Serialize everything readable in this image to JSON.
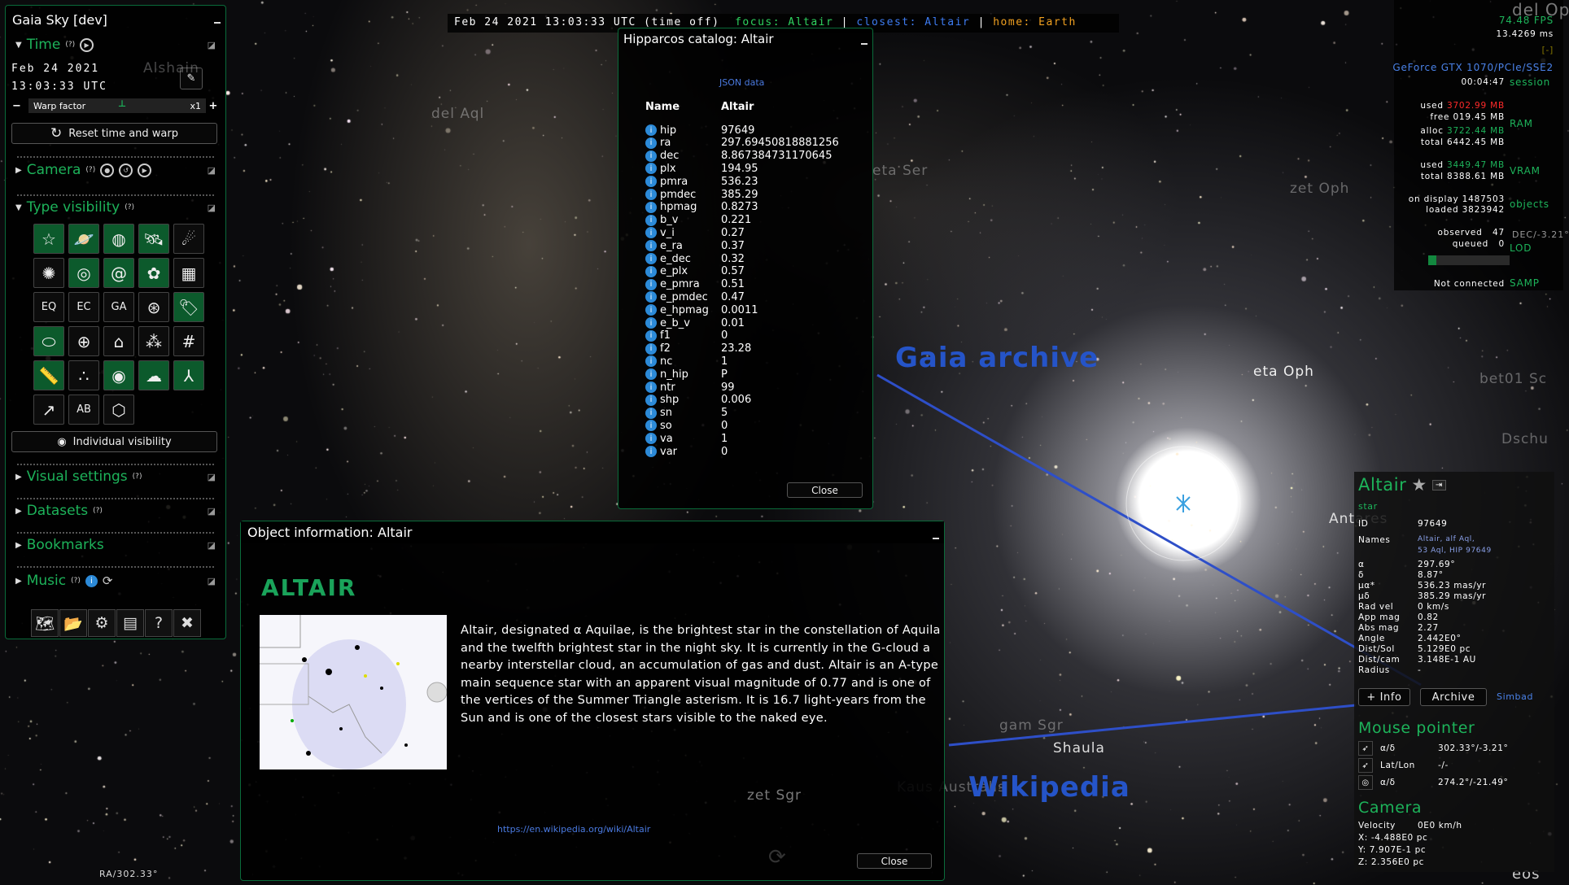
{
  "colors": {
    "accent": "#1db35a",
    "link": "#4a7ae0",
    "focus": "#2ed35f",
    "closest": "#3d7bf0",
    "home": "#f0a020",
    "warn": "#ff2a2a"
  },
  "left": {
    "title": "Gaia Sky [dev]",
    "time": {
      "label": "Time",
      "help": "(?)",
      "date": "Feb 24 2021",
      "clock": "13:03:33 UTC",
      "warp_label": "Warp factor",
      "warp_value": "x1",
      "reset": "Reset time and warp"
    },
    "camera": {
      "label": "Camera",
      "help": "(?)"
    },
    "type_visibility": {
      "label": "Type visibility",
      "help": "(?)",
      "items": [
        {
          "name": "stars",
          "glyph": "☆",
          "on": true
        },
        {
          "name": "planets",
          "glyph": "🪐",
          "on": true
        },
        {
          "name": "moons",
          "glyph": "◍",
          "on": true
        },
        {
          "name": "satellites",
          "glyph": "🛰",
          "on": true
        },
        {
          "name": "asteroids",
          "glyph": "☄",
          "on": false
        },
        {
          "name": "star-clusters",
          "glyph": "✺",
          "on": false
        },
        {
          "name": "galaxies",
          "glyph": "◎",
          "on": true
        },
        {
          "name": "milky-way",
          "glyph": "@",
          "on": true
        },
        {
          "name": "nebulae",
          "glyph": "✿",
          "on": true
        },
        {
          "name": "meshes",
          "glyph": "▦",
          "on": false
        },
        {
          "name": "equatorial-grid",
          "glyph": "EQ",
          "on": false
        },
        {
          "name": "ecliptic-grid",
          "glyph": "EC",
          "on": false
        },
        {
          "name": "galactic-grid",
          "glyph": "GA",
          "on": false
        },
        {
          "name": "orbits",
          "glyph": "⊛",
          "on": false
        },
        {
          "name": "labels",
          "glyph": "🏷",
          "on": true
        },
        {
          "name": "orbits-ellipse",
          "glyph": "⬭",
          "on": true
        },
        {
          "name": "locations",
          "glyph": "⊕",
          "on": false
        },
        {
          "name": "countries",
          "glyph": "⌂",
          "on": false
        },
        {
          "name": "constellations",
          "glyph": "⁂",
          "on": false
        },
        {
          "name": "boundaries",
          "glyph": "#",
          "on": false
        },
        {
          "name": "ruler",
          "glyph": "📏",
          "on": true
        },
        {
          "name": "particles",
          "glyph": "∴",
          "on": false
        },
        {
          "name": "atmospheres",
          "glyph": "◉",
          "on": true
        },
        {
          "name": "clouds",
          "glyph": "☁",
          "on": true
        },
        {
          "name": "axes",
          "glyph": "⅄",
          "on": true
        },
        {
          "name": "velocity-vectors",
          "glyph": "↗",
          "on": false
        },
        {
          "name": "titles",
          "glyph": "AB",
          "on": false
        },
        {
          "name": "others",
          "glyph": "⬡",
          "on": false
        }
      ]
    },
    "individual_visibility": "Individual visibility",
    "visual_settings": {
      "label": "Visual settings",
      "help": "(?)"
    },
    "datasets": {
      "label": "Datasets",
      "help": "(?)"
    },
    "bookmarks": {
      "label": "Bookmarks"
    },
    "music": {
      "label": "Music",
      "help": "(?)"
    },
    "bottom": [
      {
        "name": "map",
        "glyph": "🗺"
      },
      {
        "name": "open-folder",
        "glyph": "📂"
      },
      {
        "name": "settings",
        "glyph": "⚙"
      },
      {
        "name": "log",
        "glyph": "▤"
      },
      {
        "name": "help",
        "glyph": "?"
      },
      {
        "name": "quit",
        "glyph": "✖"
      }
    ]
  },
  "status": {
    "time": "Feb 24 2021 13:03:33 UTC (time off)",
    "focus": "focus: Altair",
    "closest": "closest: Altair",
    "home": "home: Earth",
    "sep": "|"
  },
  "hipparcos": {
    "title": "Hipparcos catalog: Altair",
    "json_link": "JSON data",
    "header": [
      "Name",
      "Altair"
    ],
    "close": "Close",
    "rows": [
      [
        "hip",
        "97649"
      ],
      [
        "ra",
        "297.69450818881256"
      ],
      [
        "dec",
        "8.867384731170645"
      ],
      [
        "plx",
        "194.95"
      ],
      [
        "pmra",
        "536.23"
      ],
      [
        "pmdec",
        "385.29"
      ],
      [
        "hpmag",
        "0.8273"
      ],
      [
        "b_v",
        "0.221"
      ],
      [
        "v_i",
        "0.27"
      ],
      [
        "e_ra",
        "0.37"
      ],
      [
        "e_dec",
        "0.32"
      ],
      [
        "e_plx",
        "0.57"
      ],
      [
        "e_pmra",
        "0.51"
      ],
      [
        "e_pmdec",
        "0.47"
      ],
      [
        "e_hpmag",
        "0.0011"
      ],
      [
        "e_b_v",
        "0.01"
      ],
      [
        "f1",
        "0"
      ],
      [
        "f2",
        "23.28"
      ],
      [
        "nc",
        "1"
      ],
      [
        "n_hip",
        "P"
      ],
      [
        "ntr",
        "99"
      ],
      [
        "shp",
        "0.006"
      ],
      [
        "sn",
        "5"
      ],
      [
        "so",
        "0"
      ],
      [
        "va",
        "1"
      ],
      [
        "var",
        "0"
      ]
    ]
  },
  "object_info": {
    "title": "Object information: Altair",
    "heading": "ALTAIR",
    "text": "Altair, designated α Aquilae, is the brightest star in the constellation of Aquila and the twelfth brightest star in the night sky. It is currently in the G-cloud a nearby interstellar cloud, an accumulation of gas and dust. Altair is an A-type main sequence star with an apparent visual magnitude of 0.77 and is one of the vertices of the Summer Triangle asterism. It is 16.7 light-years from the Sun and is one of the closest stars visible to the naked eye.",
    "link": "https://en.wikipedia.org/wiki/Altair",
    "close": "Close"
  },
  "stats": {
    "fps": "74.48 FPS",
    "ms": "13.4269 ms",
    "toggle": "[-]",
    "gpu": "GeForce GTX 1070/PCIe/SSE2",
    "session_time": "00:04:47",
    "session": "session",
    "ram": {
      "label": "RAM",
      "used": "3702.99 MB",
      "free": "019.45 MB",
      "alloc": "3722.44 MB",
      "total": "6442.45 MB"
    },
    "vram": {
      "label": "VRAM",
      "used": "3449.47 MB",
      "total": "8388.61 MB"
    },
    "objects": {
      "label": "objects",
      "on_display": "1487503",
      "loaded": "3823942"
    },
    "lod": {
      "label": "LOD",
      "observed": "47",
      "queued": "0",
      "progress": 0.1
    },
    "samp": {
      "label": "SAMP",
      "status": "Not connected"
    },
    "k": {
      "used": "used",
      "free": "free",
      "alloc": "alloc",
      "total": "total",
      "on_display": "on display",
      "loaded": "loaded",
      "observed": "observed",
      "queued": "queued"
    }
  },
  "focus": {
    "name": "Altair",
    "type": "star",
    "rows": [
      [
        "ID",
        "97649"
      ],
      [
        "Names",
        "Altair, alf Aql,"
      ],
      [
        "",
        "53 Aql, HIP 97649"
      ],
      [
        "α",
        "297.69°"
      ],
      [
        "δ",
        "8.87°"
      ],
      [
        "μα*",
        "536.23 mas/yr"
      ],
      [
        "μδ",
        "385.29 mas/yr"
      ],
      [
        "Rad vel",
        "0 km/s"
      ],
      [
        "App mag",
        "0.82"
      ],
      [
        "Abs mag",
        "2.27"
      ],
      [
        "Angle",
        "2.442E0°"
      ],
      [
        "Dist/Sol",
        "5.129E0 pc"
      ],
      [
        "Dist/cam",
        "3.148E-1 AU"
      ],
      [
        "Radius",
        "-"
      ]
    ],
    "info_btn": "+ Info",
    "archive_btn": "Archive",
    "simbad": "Simbad",
    "mouse": {
      "title": "Mouse pointer",
      "rows": [
        [
          "α/δ",
          "302.33°/-3.21°"
        ],
        [
          "Lat/Lon",
          "-/-"
        ],
        [
          "α/δ",
          "274.2°/-21.49°"
        ]
      ]
    },
    "camera": {
      "title": "Camera",
      "velocity_label": "Velocity",
      "velocity": "0E0 km/h",
      "x": "X: -4.488E0 pc",
      "y": "Y: 7.907E-1 pc",
      "z": "Z: 2.356E0 pc"
    }
  },
  "sky_labels": {
    "gaia_archive": "Gaia archive",
    "wikipedia": "Wikipedia",
    "del_aql": "del Aql",
    "eta_ser": "eta Ser",
    "zet_oph": "zet Oph",
    "eta_oph": "eta Oph",
    "antares": "Antares",
    "dschu": "Dschu",
    "bet01": "bet01 Sc",
    "shaula": "Shaula",
    "gam_sgr": "gam Sgr",
    "kaus": "Kaus Australis",
    "zet_sgr": "zet Sgr",
    "ra": "RA/302.33°",
    "dec": "DEC/-3.21°",
    "del_oph": "del Op",
    "eos": "eos",
    "alshain": "Alshain"
  }
}
